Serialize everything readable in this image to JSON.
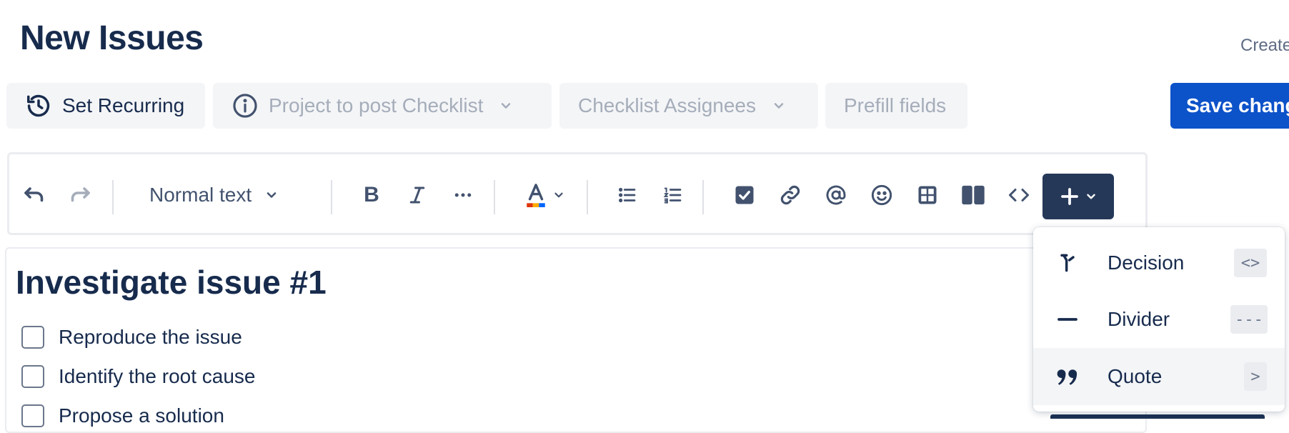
{
  "page": {
    "title": "New Issues",
    "create_link": "Create"
  },
  "top_buttons": {
    "recurring": "Set Recurring",
    "project": "Project to post Checklist",
    "assignees": "Checklist Assignees",
    "prefill": "Prefill fields",
    "save": "Save changes"
  },
  "toolbar": {
    "text_style": "Normal text",
    "icons": [
      "undo-icon",
      "redo-icon",
      "bold-icon",
      "italic-icon",
      "more-formatting-icon",
      "text-color-icon",
      "bullet-list-icon",
      "numbered-list-icon",
      "action-item-icon",
      "link-icon",
      "mention-icon",
      "emoji-icon",
      "table-icon",
      "layouts-icon",
      "code-icon",
      "insert-plus-icon"
    ]
  },
  "checklist": {
    "title": "Investigate issue #1",
    "items": [
      "Reproduce the issue",
      "Identify the root cause",
      "Propose a solution"
    ]
  },
  "insert_menu": {
    "items": [
      {
        "label": "Decision",
        "shortcut": "<>",
        "icon": "decision-icon"
      },
      {
        "label": "Divider",
        "shortcut": "---",
        "icon": "divider-icon"
      },
      {
        "label": "Quote",
        "shortcut": ">",
        "icon": "quote-icon"
      }
    ]
  },
  "colors": {
    "primary": "#0c52c9",
    "dark_button": "#253858",
    "text": "#172b4d",
    "disabled_text": "#a5adba"
  }
}
